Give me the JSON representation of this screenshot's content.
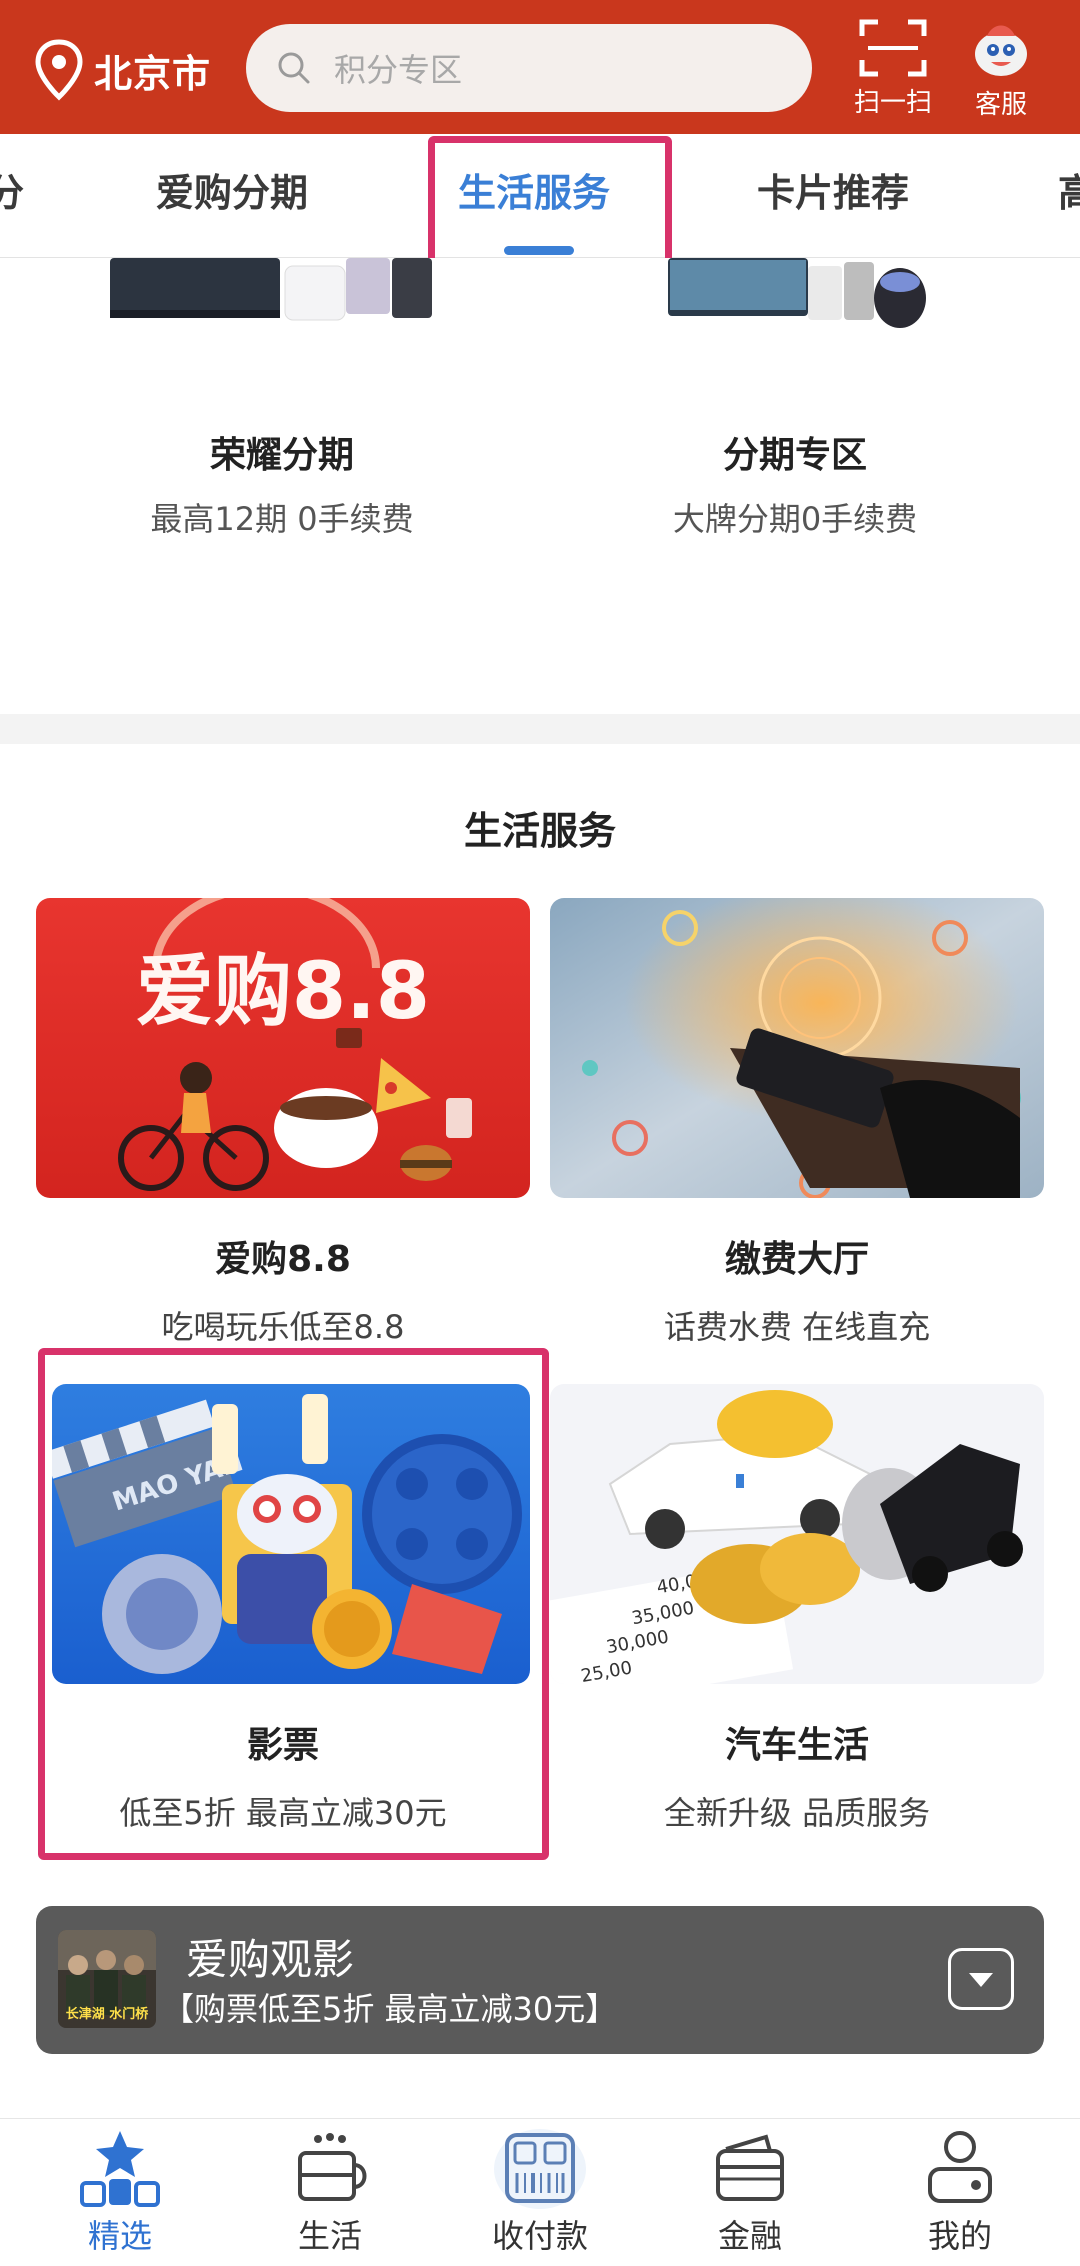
{
  "header": {
    "location": "北京市",
    "search_placeholder": "积分专区",
    "scan_label": "扫一扫",
    "service_label": "客服",
    "brand_color": "#c9371d"
  },
  "tabs": {
    "items": [
      {
        "label": "分"
      },
      {
        "label": "爱购分期"
      },
      {
        "label": "生活服务",
        "active": true
      },
      {
        "label": "卡片推荐"
      },
      {
        "label": "高"
      }
    ],
    "active_color": "#3a7fd6"
  },
  "products": [
    {
      "title": "荣耀分期",
      "subtitle": "最高12期 0手续费"
    },
    {
      "title": "分期专区",
      "subtitle": "大牌分期0手续费"
    }
  ],
  "life_services": {
    "title": "生活服务",
    "cards": [
      {
        "title": "爱购8.8",
        "subtitle": "吃喝玩乐低至8.8",
        "image_text": "爱购8.8"
      },
      {
        "title": "缴费大厅",
        "subtitle": "话费水费 在线直充"
      },
      {
        "title": "影票",
        "subtitle": "低至5折 最高立减30元",
        "image_text": "MAO YAN"
      },
      {
        "title": "汽车生活",
        "subtitle": "全新升级 品质服务",
        "image_text": [
          "40,000",
          "35,000",
          "30,000",
          "25,00"
        ]
      }
    ]
  },
  "promo": {
    "title": "爱购观影",
    "subtitle": "【购票低至5折  最高立减30元】",
    "poster_text": "长津湖 水门桥"
  },
  "bottom_nav": {
    "items": [
      {
        "label": "精选",
        "icon": "star-icon",
        "active": true
      },
      {
        "label": "生活",
        "icon": "cup-icon"
      },
      {
        "label": "收付款",
        "icon": "scan-pay-icon"
      },
      {
        "label": "金融",
        "icon": "card-icon"
      },
      {
        "label": "我的",
        "icon": "user-icon"
      }
    ],
    "active_color": "#2f72d1"
  },
  "highlight_color": "#d8326a"
}
